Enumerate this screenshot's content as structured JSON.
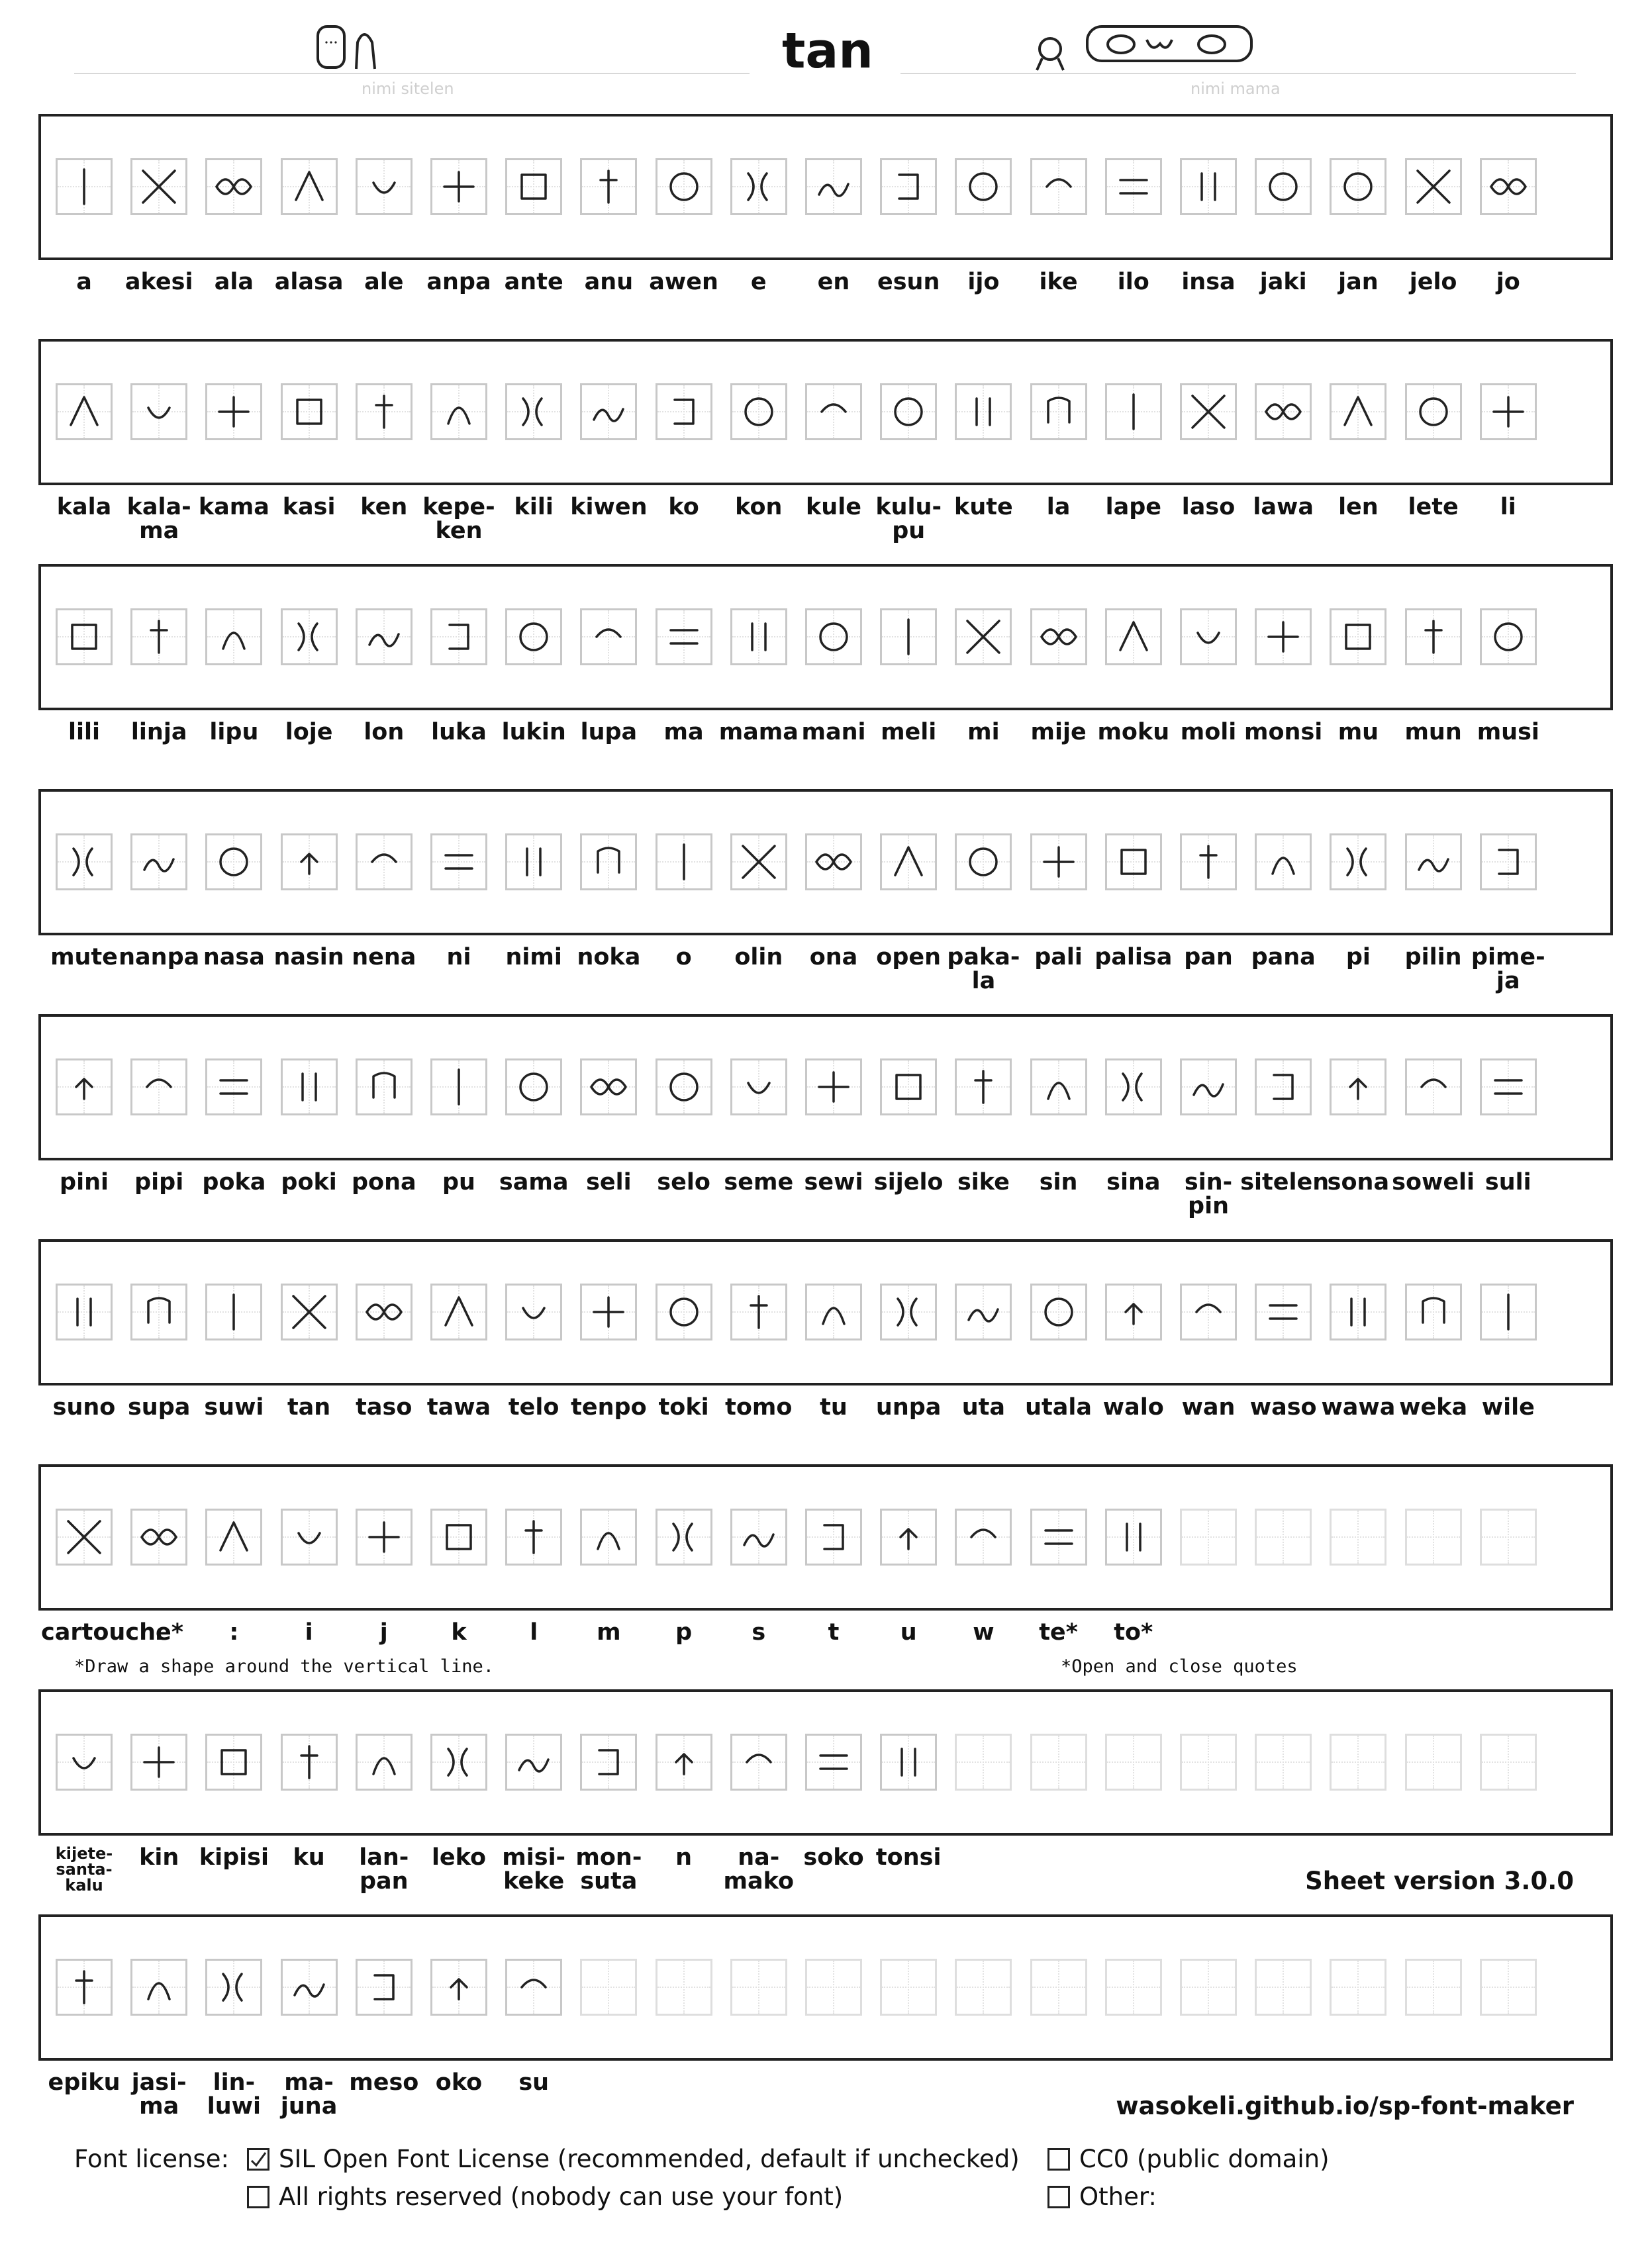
{
  "header": {
    "title": "tan",
    "left_caption": "nimi sitelen",
    "right_caption": "nimi mama"
  },
  "rows": [
    {
      "cells": [
        {
          "label": "a"
        },
        {
          "label": "akesi"
        },
        {
          "label": "ala"
        },
        {
          "label": "alasa"
        },
        {
          "label": "ale"
        },
        {
          "label": "anpa"
        },
        {
          "label": "ante"
        },
        {
          "label": "anu"
        },
        {
          "label": "awen"
        },
        {
          "label": "e"
        },
        {
          "label": "en"
        },
        {
          "label": "esun"
        },
        {
          "label": "ijo"
        },
        {
          "label": "ike"
        },
        {
          "label": "ilo"
        },
        {
          "label": "insa"
        },
        {
          "label": "jaki"
        },
        {
          "label": "jan"
        },
        {
          "label": "jelo"
        },
        {
          "label": "jo"
        }
      ]
    },
    {
      "cells": [
        {
          "label": "kala"
        },
        {
          "label": "kala-\nma"
        },
        {
          "label": "kama"
        },
        {
          "label": "kasi"
        },
        {
          "label": "ken"
        },
        {
          "label": "kepe-\nken"
        },
        {
          "label": "kili"
        },
        {
          "label": "kiwen"
        },
        {
          "label": "ko"
        },
        {
          "label": "kon"
        },
        {
          "label": "kule"
        },
        {
          "label": "kulu-\npu"
        },
        {
          "label": "kute"
        },
        {
          "label": "la"
        },
        {
          "label": "lape"
        },
        {
          "label": "laso"
        },
        {
          "label": "lawa"
        },
        {
          "label": "len"
        },
        {
          "label": "lete"
        },
        {
          "label": "li"
        }
      ]
    },
    {
      "cells": [
        {
          "label": "lili"
        },
        {
          "label": "linja"
        },
        {
          "label": "lipu"
        },
        {
          "label": "loje"
        },
        {
          "label": "lon"
        },
        {
          "label": "luka"
        },
        {
          "label": "lukin"
        },
        {
          "label": "lupa"
        },
        {
          "label": "ma"
        },
        {
          "label": "mama"
        },
        {
          "label": "mani"
        },
        {
          "label": "meli"
        },
        {
          "label": "mi"
        },
        {
          "label": "mije"
        },
        {
          "label": "moku"
        },
        {
          "label": "moli"
        },
        {
          "label": "monsi"
        },
        {
          "label": "mu"
        },
        {
          "label": "mun"
        },
        {
          "label": "musi"
        }
      ]
    },
    {
      "cells": [
        {
          "label": "mute"
        },
        {
          "label": "nanpa"
        },
        {
          "label": "nasa"
        },
        {
          "label": "nasin"
        },
        {
          "label": "nena"
        },
        {
          "label": "ni"
        },
        {
          "label": "nimi"
        },
        {
          "label": "noka"
        },
        {
          "label": "o"
        },
        {
          "label": "olin"
        },
        {
          "label": "ona"
        },
        {
          "label": "open"
        },
        {
          "label": "paka-\nla"
        },
        {
          "label": "pali"
        },
        {
          "label": "palisa"
        },
        {
          "label": "pan"
        },
        {
          "label": "pana"
        },
        {
          "label": "pi"
        },
        {
          "label": "pilin"
        },
        {
          "label": "pime-\nja"
        }
      ]
    },
    {
      "cells": [
        {
          "label": "pini"
        },
        {
          "label": "pipi"
        },
        {
          "label": "poka"
        },
        {
          "label": "poki"
        },
        {
          "label": "pona"
        },
        {
          "label": "pu"
        },
        {
          "label": "sama"
        },
        {
          "label": "seli"
        },
        {
          "label": "selo"
        },
        {
          "label": "seme"
        },
        {
          "label": "sewi"
        },
        {
          "label": "sijelo"
        },
        {
          "label": "sike"
        },
        {
          "label": "sin"
        },
        {
          "label": "sina"
        },
        {
          "label": "sin-\npin"
        },
        {
          "label": "sitelen"
        },
        {
          "label": "sona"
        },
        {
          "label": "soweli"
        },
        {
          "label": "suli"
        }
      ]
    },
    {
      "cells": [
        {
          "label": "suno"
        },
        {
          "label": "supa"
        },
        {
          "label": "suwi"
        },
        {
          "label": "tan"
        },
        {
          "label": "taso"
        },
        {
          "label": "tawa"
        },
        {
          "label": "telo"
        },
        {
          "label": "tenpo"
        },
        {
          "label": "toki"
        },
        {
          "label": "tomo"
        },
        {
          "label": "tu"
        },
        {
          "label": "unpa"
        },
        {
          "label": "uta"
        },
        {
          "label": "utala"
        },
        {
          "label": "walo"
        },
        {
          "label": "wan"
        },
        {
          "label": "waso"
        },
        {
          "label": "wawa"
        },
        {
          "label": "weka"
        },
        {
          "label": "wile"
        }
      ]
    },
    {
      "cells": [
        {
          "label": "cartouche*"
        },
        {
          "label": "."
        },
        {
          "label": ":"
        },
        {
          "label": "i"
        },
        {
          "label": "j"
        },
        {
          "label": "k"
        },
        {
          "label": "l"
        },
        {
          "label": "m"
        },
        {
          "label": "p"
        },
        {
          "label": "s"
        },
        {
          "label": "t"
        },
        {
          "label": "u"
        },
        {
          "label": "w"
        },
        {
          "label": "te*"
        },
        {
          "label": "to*"
        },
        {
          "label": ""
        },
        {
          "label": ""
        },
        {
          "label": ""
        },
        {
          "label": ""
        },
        {
          "label": ""
        }
      ]
    },
    {
      "cells": [
        {
          "label": "kijete-\nsanta-\nkalu"
        },
        {
          "label": "kin"
        },
        {
          "label": "kipisi"
        },
        {
          "label": "ku"
        },
        {
          "label": "lan-\npan"
        },
        {
          "label": "leko"
        },
        {
          "label": "misi-\nkeke"
        },
        {
          "label": "mon-\nsuta"
        },
        {
          "label": "n"
        },
        {
          "label": "na-\nmako"
        },
        {
          "label": "soko"
        },
        {
          "label": "tonsi"
        },
        {
          "label": ""
        },
        {
          "label": ""
        },
        {
          "label": ""
        },
        {
          "label": ""
        },
        {
          "label": ""
        },
        {
          "label": ""
        },
        {
          "label": ""
        },
        {
          "label": ""
        }
      ]
    },
    {
      "cells": [
        {
          "label": "epiku"
        },
        {
          "label": "jasi-\nma"
        },
        {
          "label": "lin-\nluwi"
        },
        {
          "label": "ma-\njuna"
        },
        {
          "label": "meso"
        },
        {
          "label": "oko"
        },
        {
          "label": "su"
        },
        {
          "label": ""
        },
        {
          "label": ""
        },
        {
          "label": ""
        },
        {
          "label": ""
        },
        {
          "label": ""
        },
        {
          "label": ""
        },
        {
          "label": ""
        },
        {
          "label": ""
        },
        {
          "label": ""
        },
        {
          "label": ""
        },
        {
          "label": ""
        },
        {
          "label": ""
        },
        {
          "label": ""
        }
      ]
    }
  ],
  "notes": {
    "cartouche_note": "*Draw a shape around the vertical line.",
    "quotes_note": "*Open and close quotes"
  },
  "footer": {
    "sheet_version": "Sheet version 3.0.0",
    "website": "wasokeli.github.io/sp-font-maker",
    "license_label": "Font license:",
    "options": {
      "ofl": "SIL Open Font License (recommended, default if unchecked)",
      "cc0": "CC0 (public domain)",
      "all_rights": "All rights reserved (nobody can use your font)",
      "other": "Other:"
    },
    "ofl_checked": true
  }
}
